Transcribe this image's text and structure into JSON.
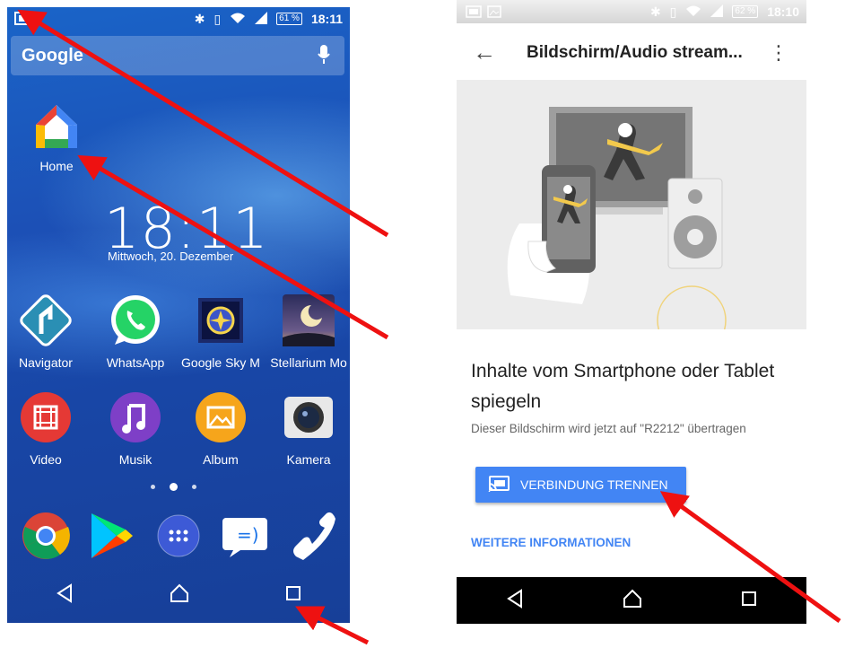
{
  "left_phone": {
    "status_bar": {
      "battery": "61 %",
      "time": "18:11"
    },
    "search_bar": {
      "logo": "Google"
    },
    "home_app": {
      "label": "Home",
      "icon": "google-home-icon"
    },
    "clock": {
      "time": "18:11",
      "date": "Mittwoch, 20. Dezember"
    },
    "apps_row1": [
      {
        "label": "Navigator",
        "icon": "navigator-icon"
      },
      {
        "label": "WhatsApp",
        "icon": "whatsapp-icon"
      },
      {
        "label": "Google Sky M",
        "icon": "sky-map-icon"
      },
      {
        "label": "Stellarium Mo",
        "icon": "stellarium-icon"
      }
    ],
    "apps_row2": [
      {
        "label": "Video",
        "icon": "video-icon"
      },
      {
        "label": "Musik",
        "icon": "music-icon"
      },
      {
        "label": "Album",
        "icon": "album-icon"
      },
      {
        "label": "Kamera",
        "icon": "camera-icon"
      }
    ],
    "dock": [
      "chrome-icon",
      "play-store-icon",
      "app-drawer-icon",
      "messaging-icon",
      "phone-icon"
    ],
    "nav": [
      "back-icon",
      "home-nav-icon",
      "recents-icon"
    ]
  },
  "right_phone": {
    "status_bar": {
      "battery": "62 %",
      "time": "18:10"
    },
    "toolbar": {
      "title": "Bildschirm/Audio stream..."
    },
    "heading": "Inhalte vom Smartphone oder Tablet spiegeln",
    "description": "Dieser Bildschirm wird jetzt auf \"R2212\" übertragen",
    "disconnect_button": {
      "label": "VERBINDUNG TRENNEN"
    },
    "more_info_link": "WEITERE INFORMATIONEN",
    "nav": [
      "back-icon",
      "home-nav-icon",
      "recents-icon"
    ]
  },
  "colors": {
    "accent": "#4285f4",
    "arrow": "#ee1111"
  }
}
